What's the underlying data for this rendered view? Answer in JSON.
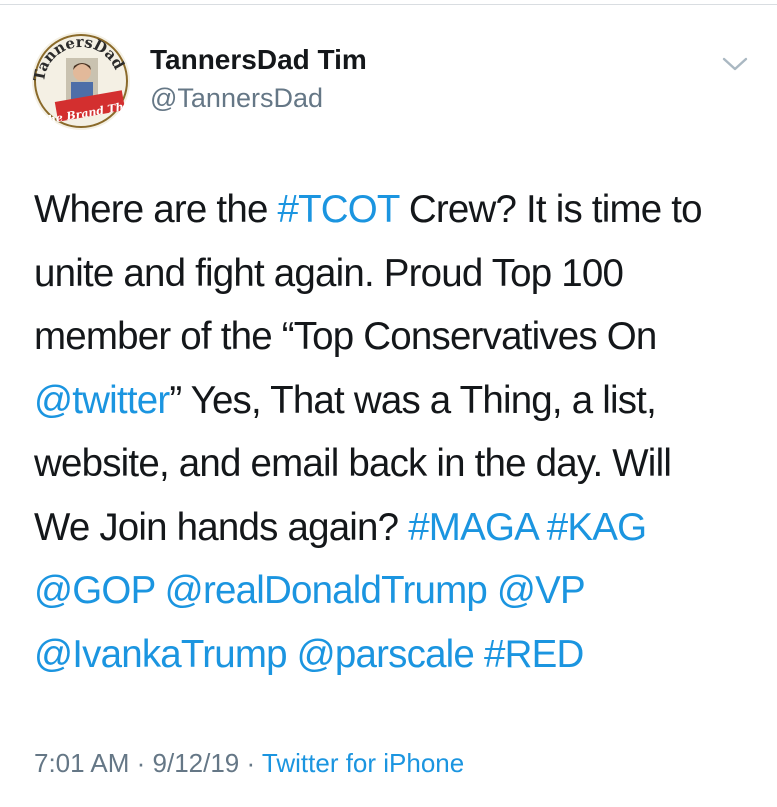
{
  "author": {
    "display_name": "TannersDad Tim",
    "handle": "@TannersDad",
    "avatar_text_top": "TannersDad",
    "avatar_text_bottom": "The Brand That Cares"
  },
  "tweet": {
    "lines": [
      [
        {
          "text": "Where are the ",
          "link": false
        },
        {
          "text": "#TCOT",
          "link": true
        },
        {
          "text": " Crew? It is time to",
          "link": false
        }
      ],
      [
        {
          "text": "unite and fight again. Proud Top 100",
          "link": false
        }
      ],
      [
        {
          "text": "member of the “Top Conservatives On",
          "link": false
        }
      ],
      [
        {
          "text": "@twitter",
          "link": true
        },
        {
          "text": "” Yes, That was a Thing, a list,",
          "link": false
        }
      ],
      [
        {
          "text": "website, and email back in the day. Will",
          "link": false
        }
      ],
      [
        {
          "text": "We Join hands again? ",
          "link": false
        },
        {
          "text": "#MAGA",
          "link": true
        },
        {
          "text": " ",
          "link": false
        },
        {
          "text": "#KAG",
          "link": true
        }
      ],
      [
        {
          "text": "@GOP",
          "link": true
        },
        {
          "text": " ",
          "link": false
        },
        {
          "text": "@realDonaldTrump",
          "link": true
        },
        {
          "text": " ",
          "link": false
        },
        {
          "text": "@VP",
          "link": true
        }
      ],
      [
        {
          "text": "@IvankaTrump",
          "link": true
        },
        {
          "text": " ",
          "link": false
        },
        {
          "text": "@parscale",
          "link": true
        },
        {
          "text": " ",
          "link": false
        },
        {
          "text": "#RED",
          "link": true
        }
      ]
    ]
  },
  "meta": {
    "time": "7:01 AM",
    "sep1": " · ",
    "date": "9/12/19",
    "sep2": " · ",
    "source": "Twitter for iPhone"
  },
  "icons": {
    "menu": "chevron-down-icon"
  },
  "colors": {
    "link": "#1b95e0",
    "text": "#14171a",
    "secondary": "#657786"
  }
}
